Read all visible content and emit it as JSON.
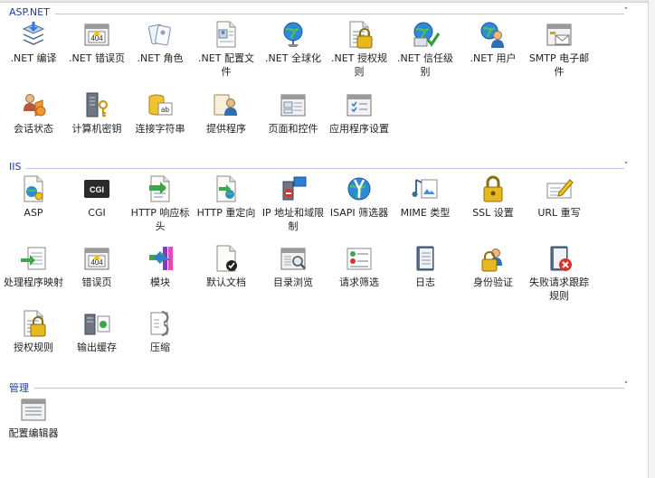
{
  "groups": [
    {
      "title": "ASP.NET",
      "items": [
        {
          "label": ".NET 编译",
          "icon": "dotnet-compilation-icon"
        },
        {
          "label": ".NET 错误页",
          "icon": "dotnet-error-pages-icon"
        },
        {
          "label": ".NET 角色",
          "icon": "dotnet-roles-icon"
        },
        {
          "label": ".NET 配置文件",
          "icon": "dotnet-profile-icon"
        },
        {
          "label": ".NET 全球化",
          "icon": "dotnet-globalization-icon"
        },
        {
          "label": ".NET 授权规则",
          "icon": "dotnet-authorization-rules-icon"
        },
        {
          "label": ".NET 信任级别",
          "icon": "dotnet-trust-levels-icon"
        },
        {
          "label": ".NET 用户",
          "icon": "dotnet-users-icon"
        },
        {
          "label": "SMTP 电子邮件",
          "icon": "smtp-email-icon"
        },
        {
          "label": "会话状态",
          "icon": "session-state-icon"
        },
        {
          "label": "计算机密钥",
          "icon": "machine-key-icon"
        },
        {
          "label": "连接字符串",
          "icon": "connection-strings-icon"
        },
        {
          "label": "提供程序",
          "icon": "providers-icon"
        },
        {
          "label": "页面和控件",
          "icon": "pages-and-controls-icon"
        },
        {
          "label": "应用程序设置",
          "icon": "application-settings-icon"
        }
      ]
    },
    {
      "title": "IIS",
      "items": [
        {
          "label": "ASP",
          "icon": "asp-icon"
        },
        {
          "label": "CGI",
          "icon": "cgi-icon"
        },
        {
          "label": "HTTP 响应标头",
          "icon": "http-response-headers-icon"
        },
        {
          "label": "HTTP 重定向",
          "icon": "http-redirect-icon"
        },
        {
          "label": "IP 地址和域限制",
          "icon": "ip-domain-restrictions-icon"
        },
        {
          "label": "ISAPI 筛选器",
          "icon": "isapi-filters-icon"
        },
        {
          "label": "MIME 类型",
          "icon": "mime-types-icon"
        },
        {
          "label": "SSL 设置",
          "icon": "ssl-settings-icon"
        },
        {
          "label": "URL 重写",
          "icon": "url-rewrite-icon"
        },
        {
          "label": "处理程序映射",
          "icon": "handler-mappings-icon"
        },
        {
          "label": "错误页",
          "icon": "error-pages-icon"
        },
        {
          "label": "模块",
          "icon": "modules-icon"
        },
        {
          "label": "默认文档",
          "icon": "default-document-icon"
        },
        {
          "label": "目录浏览",
          "icon": "directory-browsing-icon"
        },
        {
          "label": "请求筛选",
          "icon": "request-filtering-icon"
        },
        {
          "label": "日志",
          "icon": "logging-icon"
        },
        {
          "label": "身份验证",
          "icon": "authentication-icon"
        },
        {
          "label": "失败请求跟踪规则",
          "icon": "failed-request-tracing-icon"
        },
        {
          "label": "授权规则",
          "icon": "authorization-rules-icon"
        },
        {
          "label": "输出缓存",
          "icon": "output-caching-icon"
        },
        {
          "label": "压缩",
          "icon": "compression-icon"
        }
      ]
    },
    {
      "title": "管理",
      "items": [
        {
          "label": "配置编辑器",
          "icon": "configuration-editor-icon"
        }
      ]
    }
  ],
  "collapse_glyph": "˄",
  "icon_badges": {
    "error_code": "404",
    "cgi": "CGI",
    "ab": "ab"
  },
  "colors": {
    "group_title": "#1f3f99",
    "group_line": "#b9c9e6"
  }
}
